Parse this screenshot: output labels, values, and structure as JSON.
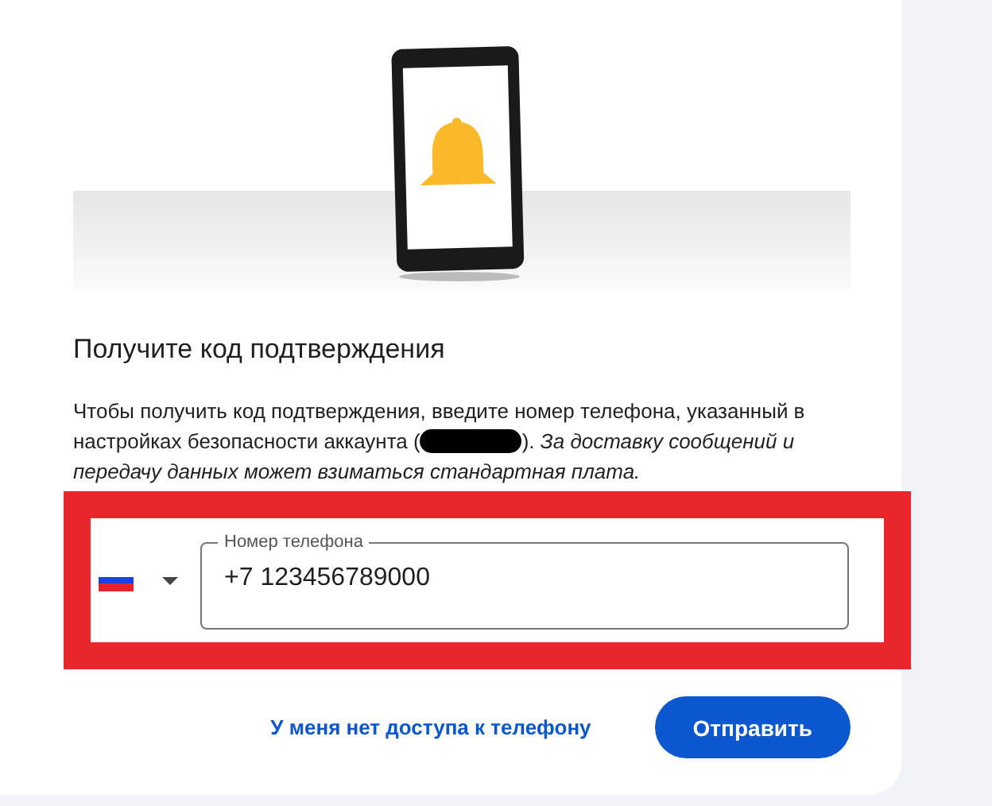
{
  "heading": "Получите код подтверждения",
  "description": {
    "before": "Чтобы получить код подтверждения, введите номер телефона, указанный в настройках безопасности аккаунта (",
    "after": "). *За доставку сообщений и передачу данных может взиматься стандартная плата.*"
  },
  "phone_field": {
    "label": "Номер телефона",
    "value": "+7 123456789000"
  },
  "no_access_link": "У меня нет доступа к телефону",
  "submit_button": "Отправить"
}
